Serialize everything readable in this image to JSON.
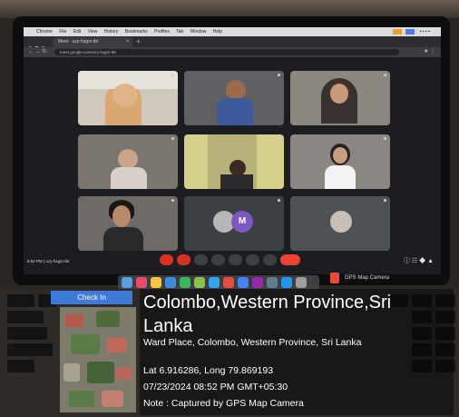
{
  "browser": {
    "tab_title": "Meet - uzy-hxgm-tbr",
    "new_tab_symbol": "+",
    "tab_close_symbol": "×",
    "url": "meet.google.com/uzy-hxgm-tbr",
    "nav_symbols": "← → ↻"
  },
  "menubar": {
    "apple": "",
    "items": [
      "Chrome",
      "File",
      "Edit",
      "View",
      "History",
      "Bookmarks",
      "Profiles",
      "Tab",
      "Window",
      "Help"
    ]
  },
  "meeting": {
    "status_text": "8:52 PM | uzy-hxgm-tbr",
    "participants": [
      {
        "name": "",
        "type": "video"
      },
      {
        "name": "",
        "type": "video"
      },
      {
        "name": "",
        "type": "video"
      },
      {
        "name": "",
        "type": "video"
      },
      {
        "name": "",
        "type": "video"
      },
      {
        "name": "",
        "type": "video"
      },
      {
        "name": "",
        "type": "video"
      },
      {
        "name": "",
        "type": "avatar",
        "initial": "M"
      },
      {
        "name": "",
        "type": "video"
      }
    ]
  },
  "dock": {
    "gps_app_label": "GPS Map Camera"
  },
  "gps_overlay": {
    "checkin_label": "Check In",
    "title": "Colombo,Western Province,Sri Lanka",
    "address": "Ward Place, Colombo, Western Province, Sri Lanka",
    "coordinates": "Lat 6.916286, Long 79.869193",
    "datetime": "07/23/2024 08:52 PM GMT+05:30",
    "note": "Note : Captured by GPS Map Camera"
  },
  "colors": {
    "checkin_button": "#3f7ad8",
    "hangup_button": "#ea4335",
    "tile_background": "#3c4043"
  }
}
